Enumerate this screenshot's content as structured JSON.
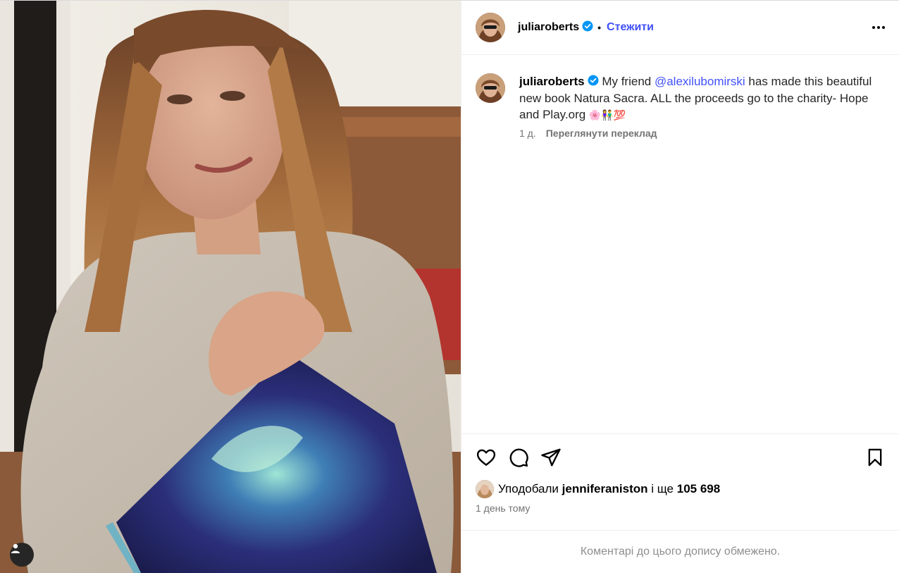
{
  "header": {
    "username": "juliaroberts",
    "separator": "•",
    "follow_label": "Стежити",
    "more_icon": "more-horizontal-icon"
  },
  "caption": {
    "username": "juliaroberts",
    "text_before": " My friend ",
    "mention": "@alexilubomirski",
    "text_after": " has made this beautiful new book Natura Sacra. ALL the proceeds go to the charity- Hope and Play.org ",
    "emojis": "🌸👫💯",
    "time": "1 д.",
    "translate_label": "Переглянути переклад"
  },
  "likes": {
    "prefix": "Уподобали",
    "liker": "jenniferaniston",
    "connector": "і ще",
    "count": "105 698"
  },
  "time_ago": "1 день тому",
  "comments_limited": "Коментарі до цього допису обмежено.",
  "colors": {
    "accent": "#4150f7",
    "verified": "#0095f6",
    "secondary_text": "#737373"
  }
}
